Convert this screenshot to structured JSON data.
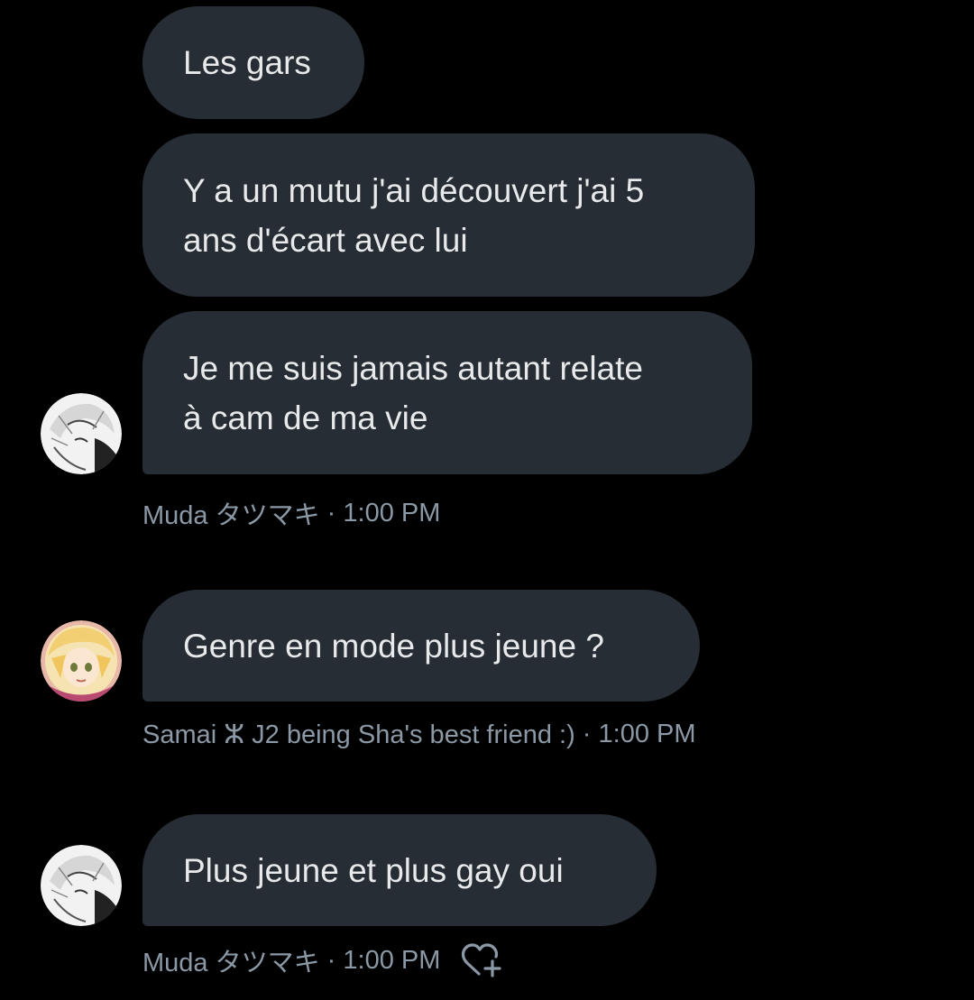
{
  "messages": [
    {
      "text": "Les gars"
    },
    {
      "text": "Y a un mutu j'ai découvert j'ai 5\nans d'écart avec lui"
    },
    {
      "text": "Je me suis jamais autant relate\nà cam de ma vie"
    },
    {
      "text": "Genre en mode plus jeune ?"
    },
    {
      "text": "Plus jeune et plus gay oui"
    }
  ],
  "meta": [
    {
      "sender": "Muda タツマキ",
      "separator": " · ",
      "time": "1:00 PM"
    },
    {
      "sender": "Samai ⵣ J2 being Sha's best friend :)",
      "separator": " · ",
      "time": "1:00 PM"
    },
    {
      "sender": "Muda タツマキ",
      "separator": " · ",
      "time": "1:00 PM"
    }
  ],
  "avatars": [
    {
      "name": "Muda タツマキ",
      "style": "manga-sketch",
      "icon": "user-avatar"
    },
    {
      "name": "Samai",
      "style": "anime-blonde",
      "icon": "user-avatar"
    },
    {
      "name": "Muda タツマキ",
      "style": "manga-sketch",
      "icon": "user-avatar"
    }
  ],
  "reaction": {
    "icon": "add-reaction-heart-icon"
  },
  "colors": {
    "background": "#000000",
    "bubble": "#262d34",
    "text": "#e7e9ea",
    "meta": "#8b98a5"
  }
}
